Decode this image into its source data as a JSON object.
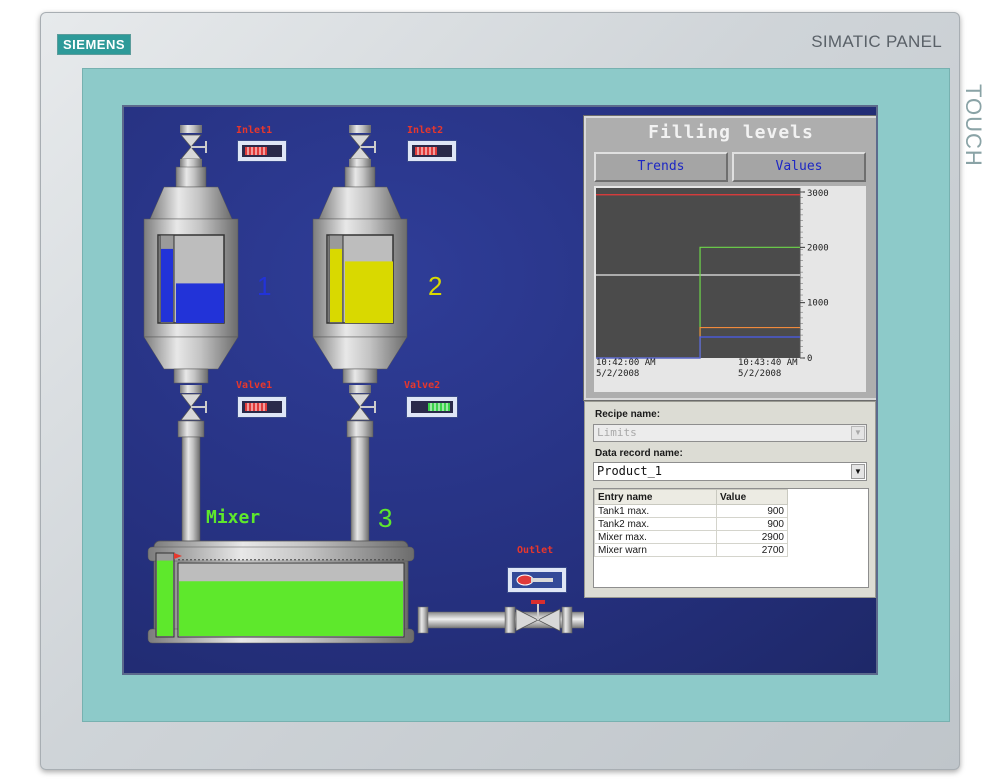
{
  "device": {
    "brand": "SIEMENS",
    "panel_name": "SIMATIC PANEL",
    "panel_type": "TOUCH"
  },
  "process": {
    "inlet1_label": "Inlet1",
    "inlet2_label": "Inlet2",
    "valve1_label": "Valve1",
    "valve2_label": "Valve2",
    "outlet_label": "Outlet",
    "tank1_number": "1",
    "tank2_number": "2",
    "mixer_label": "Mixer",
    "mixer_number": "3",
    "tank1_level": 0.45,
    "tank2_level": 0.7,
    "mixer_level": 0.75,
    "mixer_warn_level": 0.93,
    "colors": {
      "tank1_fill": "#2233d8",
      "tank2_fill": "#d9d900",
      "mixer_fill": "#5ee82c",
      "label_red": "#e8372c",
      "mixer_text": "#5ee82c"
    },
    "states": {
      "inlet1": "closed",
      "inlet2": "closed",
      "valve1": "closed",
      "valve2": "open",
      "outlet": "closed"
    }
  },
  "filling_levels": {
    "title": "Filling levels",
    "tab_trends": "Trends",
    "tab_values": "Values",
    "trend": {
      "y_ticks": [
        "3000",
        "2000",
        "1000",
        "0"
      ],
      "x_start_time": "10:42:00 AM",
      "x_start_date": "5/2/2008",
      "x_end_time": "10:43:40 AM",
      "x_end_date": "5/2/2008"
    }
  },
  "chart_data": {
    "type": "line",
    "x": [
      "10:42:00 AM",
      "10:43:40 AM"
    ],
    "ylim": [
      0,
      3000
    ],
    "grid": false,
    "series": [
      {
        "color": "#e83a3a",
        "points": [
          [
            0,
            2950
          ],
          [
            100,
            2950
          ]
        ]
      },
      {
        "color": "#e6e6e6",
        "points": [
          [
            0,
            1500
          ],
          [
            100,
            1500
          ]
        ]
      },
      {
        "color": "#6ed84a",
        "points": [
          [
            0,
            0
          ],
          [
            51,
            0
          ],
          [
            51,
            2000
          ],
          [
            100,
            2000
          ]
        ]
      },
      {
        "color": "#f08a3c",
        "points": [
          [
            0,
            0
          ],
          [
            51,
            0
          ],
          [
            51,
            550
          ],
          [
            100,
            550
          ]
        ]
      },
      {
        "color": "#4a5cf0",
        "points": [
          [
            0,
            0
          ],
          [
            51,
            0
          ],
          [
            51,
            380
          ],
          [
            100,
            380
          ]
        ]
      }
    ]
  },
  "recipe": {
    "recipe_name_label": "Recipe name:",
    "recipe_name_value": "Limits",
    "record_name_label": "Data record name:",
    "record_name_value": "Product_1",
    "columns": [
      "Entry name",
      "Value"
    ],
    "rows": [
      {
        "name": "Tank1 max.",
        "value": "900"
      },
      {
        "name": "Tank2 max.",
        "value": "900"
      },
      {
        "name": "Mixer max.",
        "value": "2900"
      },
      {
        "name": "Mixer warn",
        "value": "2700"
      }
    ]
  }
}
